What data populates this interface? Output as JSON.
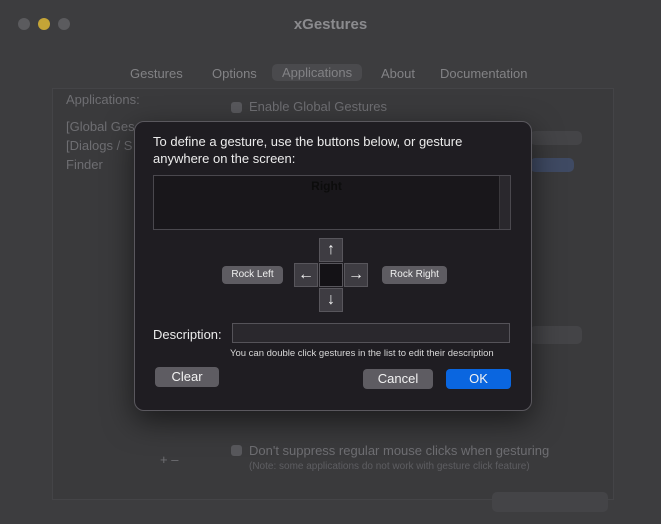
{
  "window": {
    "title": "xGestures",
    "tabs": [
      "Gestures",
      "Options",
      "Applications",
      "About",
      "Documentation"
    ],
    "selected_tab": "Applications"
  },
  "background": {
    "applications_label": "Applications:",
    "enable_global": "Enable Global Gestures",
    "app_list": [
      "[Global Ges",
      "[Dialogs / S",
      "Finder"
    ],
    "dont_suppress": "Don't suppress regular mouse clicks when gesturing",
    "note": "(Note: some applications do not work with gesture click feature)"
  },
  "dialog": {
    "prompt": "To define a gesture, use the buttons below, or gesture anywhere on the screen:",
    "gesture_text": "Right",
    "arrows": {
      "up": "↑",
      "down": "↓",
      "left": "←",
      "right": "→"
    },
    "rock_left": "Rock Left",
    "rock_right": "Rock Right",
    "description_label": "Description:",
    "description_value": "",
    "hint": "You can double click gestures in the list to edit their description",
    "clear": "Clear",
    "cancel": "Cancel",
    "ok": "OK"
  },
  "colors": {
    "accent": "#0a66e0",
    "dialog_bg": "#1f1d22",
    "window_bg": "#3d3d3f"
  }
}
